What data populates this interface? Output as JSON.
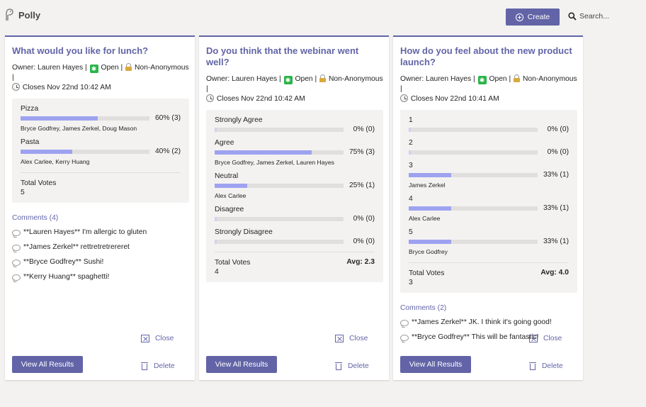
{
  "app": {
    "name": "Polly"
  },
  "header": {
    "create_label": "Create",
    "search_placeholder": "Search..."
  },
  "colors": {
    "accent": "#6264a7",
    "bar_fill": "#9ea2f0",
    "bar_track": "#e1dfdd",
    "open_badge": "#2bb44a"
  },
  "icons": [
    "polly-logo-icon",
    "plus-circle-icon",
    "search-icon",
    "check-badge-icon",
    "lock-icon",
    "clock-icon",
    "comment-icon",
    "close-box-icon",
    "trash-icon"
  ],
  "cards": [
    {
      "question": "What would you like for lunch?",
      "owner": "Owner: Lauren Hayes |",
      "status": "Open |",
      "anon": "Non-Anonymous |",
      "closes": "Closes Nov 22nd 10:42 AM",
      "options": [
        {
          "label": "Pizza",
          "pct": "60% (3)",
          "fraction": 0.6,
          "voters": "Bryce Godfrey, James Zerkel, Doug Mason"
        },
        {
          "label": "Pasta",
          "pct": "40% (2)",
          "fraction": 0.4,
          "voters": "Alex Carlee, Kerry Huang"
        }
      ],
      "total_label": "Total Votes",
      "total": "5",
      "avg": "",
      "comments_header": "Comments (4)",
      "comments": [
        "**Lauren Hayes** I'm allergic to gluten",
        "**James Zerkel** rettretretrereret",
        "**Bryce Godfrey** Sushi!",
        "**Kerry Huang** spaghetti!"
      ],
      "close_label": "Close",
      "delete_label": "Delete",
      "view_label": "View All Results"
    },
    {
      "question": "Do you think that the webinar went well?",
      "owner": "Owner: Lauren Hayes |",
      "status": "Open |",
      "anon": "Non-Anonymous |",
      "closes": "Closes Nov 22nd 10:42 AM",
      "options": [
        {
          "label": "Strongly Agree",
          "pct": "0% (0)",
          "fraction": 0,
          "voters": ""
        },
        {
          "label": "Agree",
          "pct": "75% (3)",
          "fraction": 0.75,
          "voters": "Bryce Godfrey, James Zerkel, Lauren Hayes"
        },
        {
          "label": "Neutral",
          "pct": "25% (1)",
          "fraction": 0.25,
          "voters": "Alex Carlee"
        },
        {
          "label": "Disagree",
          "pct": "0% (0)",
          "fraction": 0,
          "voters": ""
        },
        {
          "label": "Strongly Disagree",
          "pct": "0% (0)",
          "fraction": 0,
          "voters": ""
        }
      ],
      "total_label": "Total Votes",
      "total": "4",
      "avg": "Avg: 2.3",
      "comments_header": "",
      "comments": [],
      "close_label": "Close",
      "delete_label": "Delete",
      "view_label": "View All Results"
    },
    {
      "question": "How do you feel about the new product launch?",
      "owner": "Owner: Lauren Hayes |",
      "status": "Open |",
      "anon": "Non-Anonymous |",
      "closes": "Closes Nov 22nd 10:41 AM",
      "options": [
        {
          "label": "1",
          "pct": "0% (0)",
          "fraction": 0,
          "voters": ""
        },
        {
          "label": "2",
          "pct": "0% (0)",
          "fraction": 0,
          "voters": ""
        },
        {
          "label": "3",
          "pct": "33% (1)",
          "fraction": 0.33,
          "voters": "James Zerkel"
        },
        {
          "label": "4",
          "pct": "33% (1)",
          "fraction": 0.33,
          "voters": "Alex Carlee"
        },
        {
          "label": "5",
          "pct": "33% (1)",
          "fraction": 0.33,
          "voters": "Bryce Godfrey"
        }
      ],
      "total_label": "Total Votes",
      "total": "3",
      "avg": "Avg: 4.0",
      "comments_header": "Comments (2)",
      "comments": [
        "**James Zerkel** JK. I think it's going good!",
        "**Bryce Godfrey** This will be fantastic!"
      ],
      "close_label": "Close",
      "delete_label": "Delete",
      "view_label": "View All Results"
    }
  ]
}
